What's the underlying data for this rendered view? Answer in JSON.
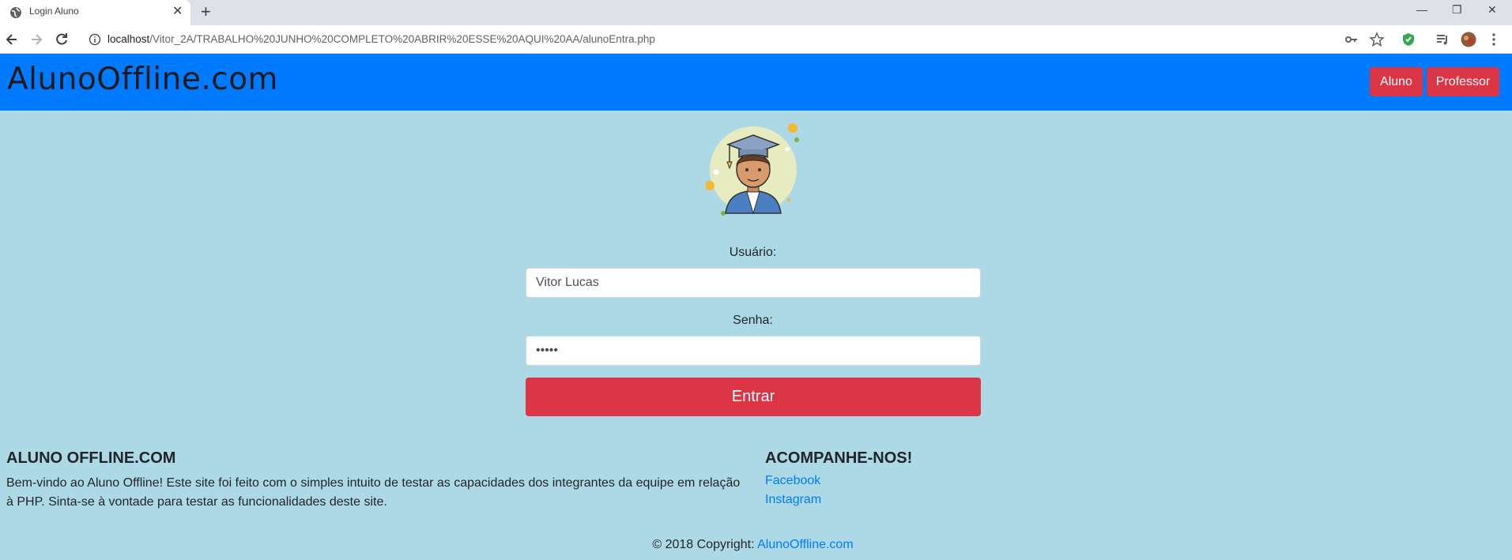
{
  "browser": {
    "tab_title": "Login Aluno",
    "url_host": "localhost",
    "url_path": "/Vitor_2A/TRABALHO%20JUNHO%20COMPLETO%20ABRIR%20ESSE%20AQUI%20AA/alunoEntra.php"
  },
  "navbar": {
    "brand": "AlunoOffline.com",
    "aluno_label": "Aluno",
    "professor_label": "Professor",
    "background": "#007bff",
    "button_color": "#dc3545"
  },
  "form": {
    "usuario_label": "Usuário:",
    "usuario_value": "Vitor Lucas",
    "senha_label": "Senha:",
    "senha_value": "•••••",
    "submit_label": "Entrar"
  },
  "footer": {
    "about_title": "ALUNO OFFLINE.COM",
    "about_text": "Bem-vindo ao Aluno Offline! Este site foi feito com o simples intuito de testar as capacidades dos integrantes da equipe em relação à PHP. Sinta-se à vontade para testar as funcionalidades deste site.",
    "follow_title": "ACOMPANHE-NOS!",
    "links": [
      "Facebook",
      "Instagram"
    ],
    "copyright_prefix": "© 2018 Copyright: ",
    "copyright_link": "AlunoOffline.com"
  },
  "colors": {
    "page_background": "#add8e6",
    "link": "#007bff"
  }
}
